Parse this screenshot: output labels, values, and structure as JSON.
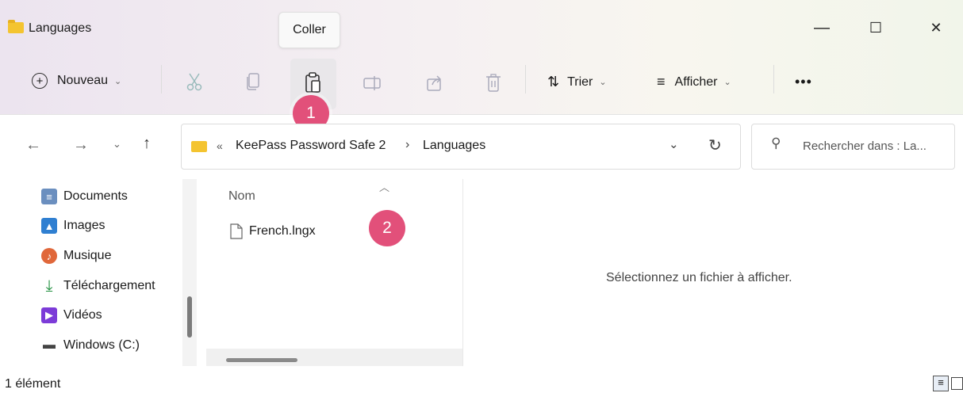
{
  "window": {
    "title": "Languages",
    "minimize": "—",
    "maximize": "☐",
    "close": "✕",
    "tooltip": "Coller"
  },
  "toolbar": {
    "new_label": "Nouveau",
    "sort_label": "Trier",
    "view_label": "Afficher",
    "more_label": "•••"
  },
  "annotations": [
    "1",
    "2"
  ],
  "address": {
    "prefix": "«",
    "segments": [
      "KeePass Password Safe 2",
      "Languages"
    ],
    "separator": "›"
  },
  "search": {
    "placeholder": "Rechercher dans : La..."
  },
  "sidebar": {
    "items": [
      {
        "label": "Documents",
        "icon": "document-icon",
        "color": "#6b8fbf"
      },
      {
        "label": "Images",
        "icon": "image-icon",
        "color": "#2f7fd1"
      },
      {
        "label": "Musique",
        "icon": "music-icon",
        "color": "#e0673a"
      },
      {
        "label": "Téléchargement",
        "icon": "download-icon",
        "color": "#1f8e3d"
      },
      {
        "label": "Vidéos",
        "icon": "video-icon",
        "color": "#7c3bd8"
      },
      {
        "label": "Windows (C:)",
        "icon": "drive-icon",
        "color": "#555555"
      }
    ]
  },
  "files": {
    "column_header": "Nom",
    "items": [
      {
        "name": "French.lngx"
      }
    ]
  },
  "preview": {
    "message": "Sélectionnez un fichier à afficher."
  },
  "status": {
    "count": "1 élément"
  },
  "colors": {
    "badge": "#e2507a",
    "folder": "#f4c430"
  }
}
